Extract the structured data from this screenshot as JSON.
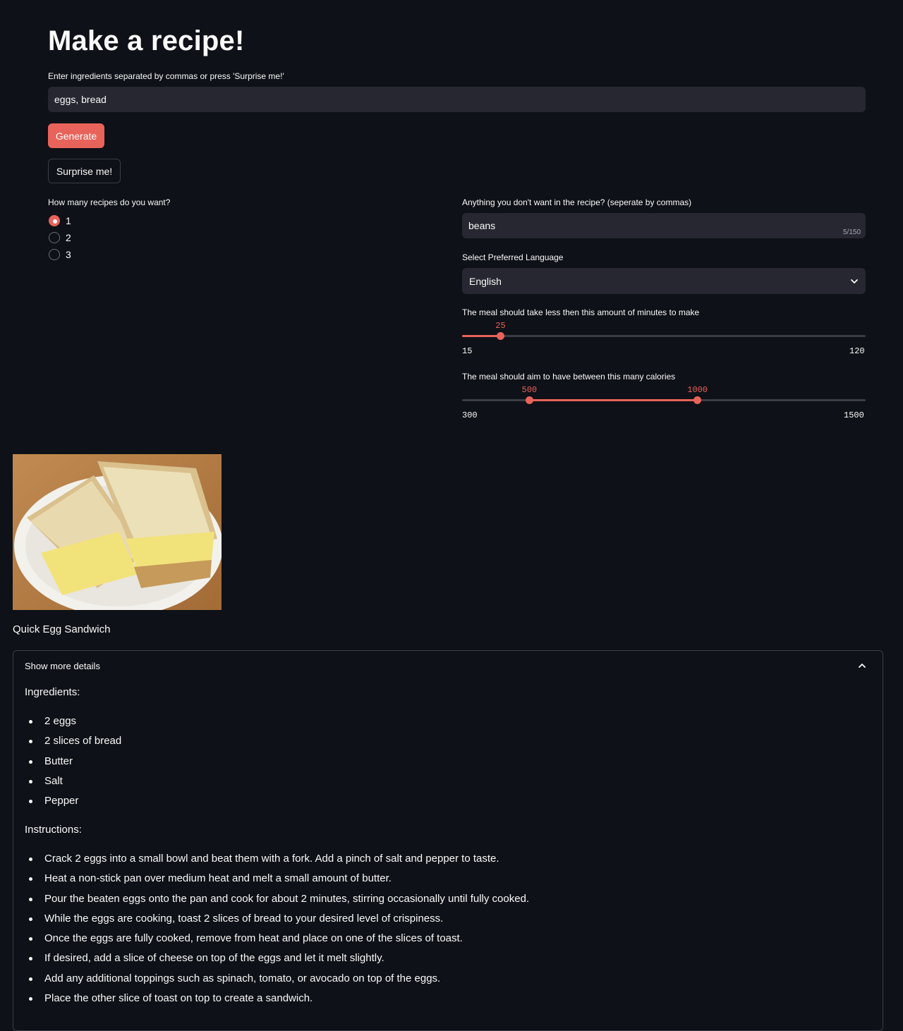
{
  "header": {
    "title": "Make a recipe!"
  },
  "ingredients_input": {
    "label": "Enter ingredients separated by commas or press 'Surprise me!'",
    "value": "eggs, bread"
  },
  "buttons": {
    "generate": "Generate",
    "surprise": "Surprise me!"
  },
  "recipe_count": {
    "label": "How many recipes do you want?",
    "options": [
      "1",
      "2",
      "3"
    ],
    "selected": "1"
  },
  "exclusions": {
    "label": "Anything you don't want in the recipe? (seperate by commas)",
    "value": "beans",
    "char_count": "5/150"
  },
  "language": {
    "label": "Select Preferred Language",
    "selected": "English"
  },
  "time_slider": {
    "label": "The meal should take less then this amount of minutes to make",
    "min": 15,
    "max": 120,
    "value": 25,
    "min_label": "15",
    "max_label": "120",
    "value_label": "25"
  },
  "calorie_slider": {
    "label": "The meal should aim to have between this many calories",
    "min": 300,
    "max": 1500,
    "low": 500,
    "high": 1000,
    "min_label": "300",
    "max_label": "1500",
    "low_label": "500",
    "high_label": "1000"
  },
  "recipe": {
    "title": "Quick Egg Sandwich",
    "expander_label": "Show more details",
    "ingredients_heading": "Ingredients:",
    "ingredients": [
      "2 eggs",
      "2 slices of bread",
      "Butter",
      "Salt",
      "Pepper"
    ],
    "instructions_heading": "Instructions:",
    "instructions": [
      "Crack 2 eggs into a small bowl and beat them with a fork. Add a pinch of salt and pepper to taste.",
      "Heat a non-stick pan over medium heat and melt a small amount of butter.",
      "Pour the beaten eggs onto the pan and cook for about 2 minutes, stirring occasionally until fully cooked.",
      "While the eggs are cooking, toast 2 slices of bread to your desired level of crispiness.",
      "Once the eggs are fully cooked, remove from heat and place on one of the slices of toast.",
      "If desired, add a slice of cheese on top of the eggs and let it melt slightly.",
      "Add any additional toppings such as spinach, tomato, or avocado on top of the eggs.",
      "Place the other slice of toast on top to create a sandwich."
    ]
  },
  "colors": {
    "background": "#0e1117",
    "input_bg": "#262730",
    "accent": "#e8635a",
    "text": "#fafafa"
  },
  "icons": {
    "select_arrow": "chevron-down-icon",
    "expander_toggle": "chevron-up-icon"
  }
}
